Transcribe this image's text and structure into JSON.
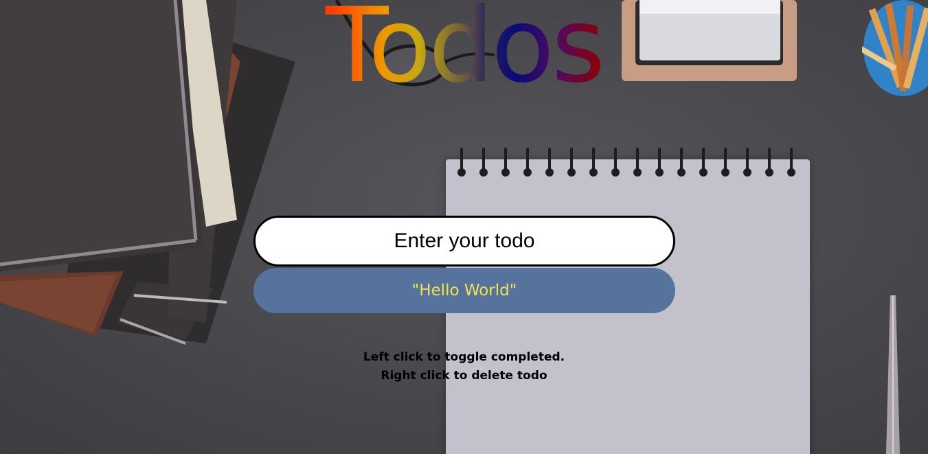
{
  "app": {
    "title": "Todos"
  },
  "input": {
    "placeholder": "Enter your todo",
    "value": ""
  },
  "todos": [
    {
      "text": "\"Hello World\"",
      "completed": false
    }
  ],
  "instructions": {
    "line1": "Left click to toggle completed.",
    "line2": "Right click to delete todo"
  },
  "colors": {
    "todo_background": "#56739d",
    "todo_text": "#f3e34a",
    "input_border": "#000000",
    "title_gradient": [
      "#ff1500",
      "#ec9a00",
      "#0a0a78",
      "#950010"
    ]
  }
}
